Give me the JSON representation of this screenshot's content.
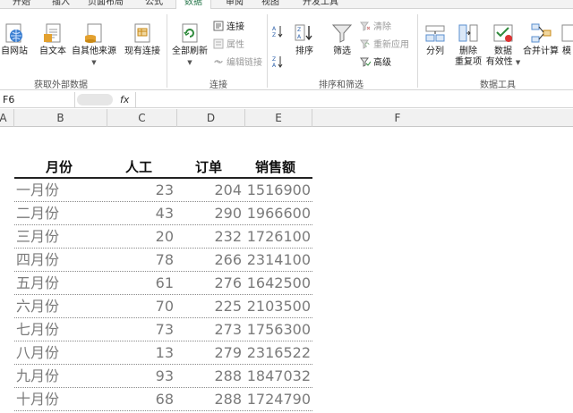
{
  "tabs": [
    {
      "label": "开始",
      "active": false
    },
    {
      "label": "插入",
      "active": false
    },
    {
      "label": "页面布局",
      "active": false
    },
    {
      "label": "公式",
      "active": false
    },
    {
      "label": "数据",
      "active": true
    },
    {
      "label": "审阅",
      "active": false
    },
    {
      "label": "视图",
      "active": false
    },
    {
      "label": "开发工具",
      "active": false
    }
  ],
  "ribbon": {
    "external": {
      "from_web": "自网站",
      "from_text": "自文本",
      "from_other": "自其他来源",
      "existing": "现有连接",
      "group": "获取外部数据"
    },
    "connections": {
      "refresh_all": "全部刷新",
      "connections": "连接",
      "properties": "属性",
      "edit_links": "编辑链接",
      "group": "连接"
    },
    "sort_filter": {
      "sort": "排序",
      "filter": "筛选",
      "clear": "清除",
      "reapply": "重新应用",
      "advanced": "高级",
      "group": "排序和筛选"
    },
    "tools": {
      "text_to_columns": "分列",
      "remove_dup_1": "删除",
      "remove_dup_2": "重复项",
      "validation_1": "数据",
      "validation_2": "有效性",
      "consolidate": "合并计算",
      "whatif": "模",
      "group": "数据工具"
    },
    "colors": {
      "accent": "#217346",
      "disabled": "#9a9a9a"
    }
  },
  "formula_bar": {
    "name_box": "F6",
    "fx": "fx",
    "value": ""
  },
  "columns": [
    "A",
    "B",
    "C",
    "D",
    "E",
    "F"
  ],
  "table": {
    "headers": {
      "month": "月份",
      "labor": "人工",
      "orders": "订单",
      "sales": "销售额"
    },
    "rows": [
      {
        "month": "一月份",
        "labor": "23",
        "orders": "204",
        "sales": "1516900"
      },
      {
        "month": "二月份",
        "labor": "43",
        "orders": "290",
        "sales": "1966600"
      },
      {
        "month": "三月份",
        "labor": "20",
        "orders": "232",
        "sales": "1726100"
      },
      {
        "month": "四月份",
        "labor": "78",
        "orders": "266",
        "sales": "2314100"
      },
      {
        "month": "五月份",
        "labor": "61",
        "orders": "276",
        "sales": "1642500"
      },
      {
        "month": "六月份",
        "labor": "70",
        "orders": "225",
        "sales": "2103500"
      },
      {
        "month": "七月份",
        "labor": "73",
        "orders": "273",
        "sales": "1756300"
      },
      {
        "month": "八月份",
        "labor": "13",
        "orders": "279",
        "sales": "2316522"
      },
      {
        "month": "九月份",
        "labor": "93",
        "orders": "288",
        "sales": "1847032"
      },
      {
        "month": "十月份",
        "labor": "68",
        "orders": "288",
        "sales": "1724790"
      }
    ]
  }
}
